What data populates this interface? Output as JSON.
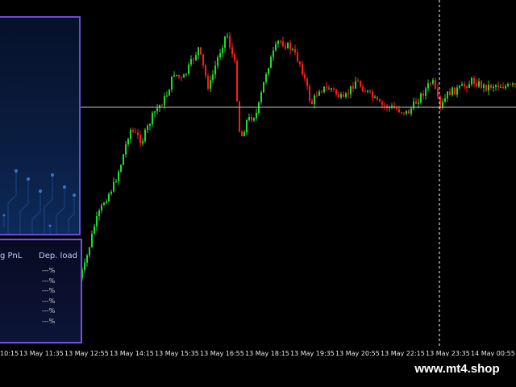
{
  "panel": {
    "col_pnl": "g PnL",
    "col_dep_load": "Dep. load",
    "dep_load_values": [
      "---%",
      "---%",
      "---%",
      "---%",
      "---%",
      "---%"
    ]
  },
  "time_axis": {
    "labels": [
      "10:15",
      "13 May 11:35",
      "13 May 12:55",
      "13 May 14:15",
      "13 May 15:35",
      "13 May 16:55",
      "13 May 18:15",
      "13 May 19:35",
      "13 May 20:55",
      "13 May 22:15",
      "13 May 23:35",
      "14 May 00:55"
    ]
  },
  "watermark": "www.mt4.shop",
  "colors": {
    "bull": "#1fdc2b",
    "bear": "#ff1a1a",
    "bid_line": "#c0c0c0",
    "grid": "#555555",
    "panel_border": "#7a4fe0"
  }
}
